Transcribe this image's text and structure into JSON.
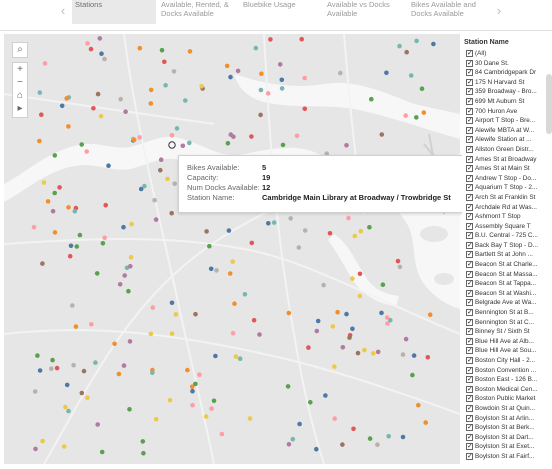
{
  "tabs": [
    {
      "label": "Stations",
      "active": true
    },
    {
      "label": "Available, Rented, & Docks Available",
      "active": false
    },
    {
      "label": "Bluebike Usage",
      "active": false
    },
    {
      "label": "Available vs Docks Available",
      "active": false
    },
    {
      "label": "Bikes Available and Docks Available",
      "active": false
    }
  ],
  "nav": {
    "prev": "‹",
    "next": "›"
  },
  "map_tools": {
    "search": "⌕",
    "zoom_in": "+",
    "zoom_out": "−",
    "home": "⌂",
    "play": "▸"
  },
  "tooltip": {
    "rows": [
      {
        "label": "Bikes Available:",
        "value": "5"
      },
      {
        "label": "Capacity:",
        "value": "19"
      },
      {
        "label": "Num Docks Available:",
        "value": "12"
      },
      {
        "label": "Station Name:",
        "value": "Cambridge Main Library at Broadway / Trowbridge St"
      }
    ]
  },
  "legend": {
    "title": "Station Name",
    "items": [
      "(All)",
      "30 Dane St.",
      "84 Cambridgepark Dr",
      "175 N Harvard St",
      "359 Broadway - Bro...",
      "699 Mt Auburn St",
      "700 Huron Ave",
      "Airport T Stop - Bre...",
      "Alewife MBTA at W...",
      "Alewife Station at ...",
      "Allston Green Distr...",
      "Ames St at Broadway",
      "Ames St at Main St",
      "Andrew T Stop - Do...",
      "Aquarium T Stop - 2...",
      "Arch St at Franklin St",
      "Archdale Rd at Was...",
      "Ashmont T Stop",
      "Assembly Square T",
      "B.U. Central - 725 C...",
      "Back Bay T Stop - D...",
      "Bartlett St at John ...",
      "Beacon St at Charle...",
      "Beacon St at Massa...",
      "Beacon St at Tappa...",
      "Beacon St at Washi...",
      "Belgrade Ave at Wa...",
      "Bennington St at B...",
      "Bennington St at C...",
      "Binney St / Sixth St",
      "Blue Hill Ave at Alb...",
      "Blue Hill Ave at Sou...",
      "Boston City Hall - 2...",
      "Boston Convention ...",
      "Boston East - 126 B...",
      "Boston Medical Cen...",
      "Boston Public Market",
      "Bowdoin St at Quin...",
      "Boylston St at Arlin...",
      "Boylston St at Berk...",
      "Boylston St at Dart...",
      "Boylston St at Exet...",
      "Boylston St at Fairf..."
    ]
  },
  "map_colors": {
    "land": "#e6e6e6",
    "water": "#f7f7f7",
    "roads": "#f2f2f2",
    "rail": "#d4d4d4"
  },
  "dot_palette": [
    "#4e79a7",
    "#f28e2b",
    "#e15759",
    "#76b7b2",
    "#59a14f",
    "#edc948",
    "#b07aa1",
    "#ff9da7",
    "#9c755f",
    "#bab0ac"
  ]
}
